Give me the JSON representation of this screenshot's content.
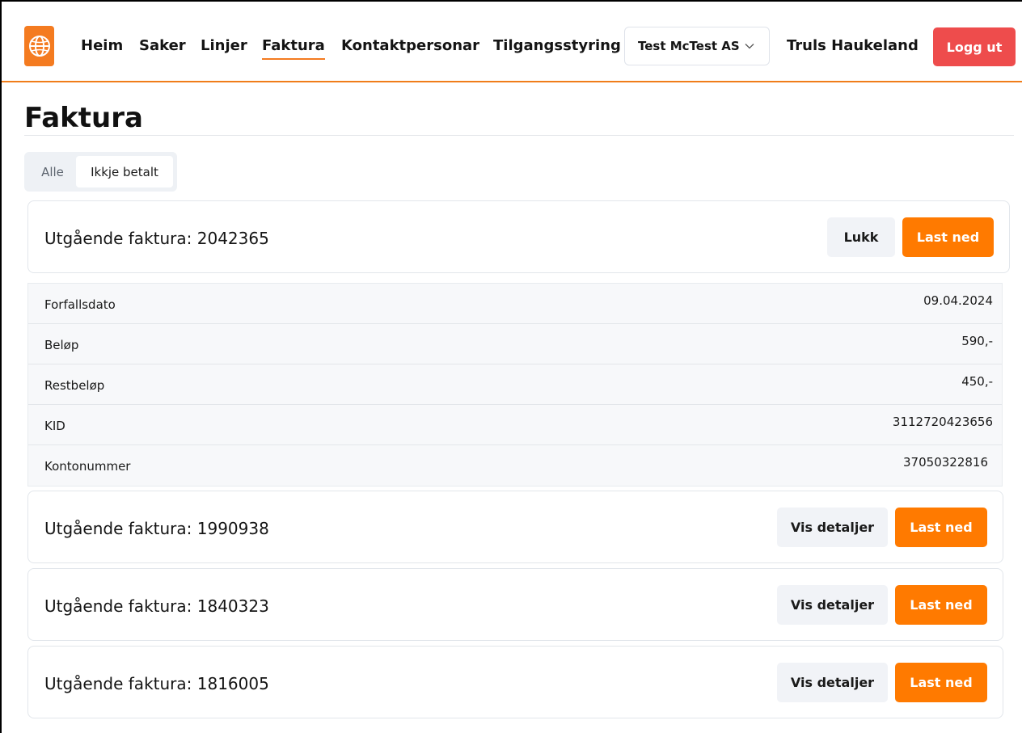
{
  "brand": {
    "accent": "#f47b20",
    "logout_color": "#ee4c4c",
    "primary_button": "#ff7a00",
    "logo_icon": "globe-icon"
  },
  "nav": {
    "items": [
      {
        "label": "Heim"
      },
      {
        "label": "Saker"
      },
      {
        "label": "Linjer"
      },
      {
        "label": "Faktura",
        "active": true
      },
      {
        "label": "Kontaktpersonar"
      },
      {
        "label": "Tilgangsstyring"
      }
    ],
    "company_select": "Test McTest AS",
    "user_name": "Truls Haukeland",
    "logout_label": "Logg ut"
  },
  "page": {
    "title": "Faktura"
  },
  "tabs": [
    {
      "label": "Alle"
    },
    {
      "label": "Ikkje betalt",
      "selected": true
    }
  ],
  "invoices": [
    {
      "title": "Utgående faktura: 2042365",
      "toggle_label": "Lukk",
      "download_label": "Last ned",
      "expanded": true,
      "details": [
        {
          "label": "Forfallsdato",
          "value": "09.04.2024"
        },
        {
          "label": "Beløp",
          "value": "590,-"
        },
        {
          "label": "Restbeløp",
          "value": "450,-"
        },
        {
          "label": "KID",
          "value": "3112720423656"
        },
        {
          "label": "Kontonummer",
          "value": "37050322816"
        }
      ]
    },
    {
      "title": "Utgående faktura: 1990938",
      "toggle_label": "Vis detaljer",
      "download_label": "Last ned"
    },
    {
      "title": "Utgående faktura: 1840323",
      "toggle_label": "Vis detaljer",
      "download_label": "Last ned"
    },
    {
      "title": "Utgående faktura: 1816005",
      "toggle_label": "Vis detaljer",
      "download_label": "Last ned"
    }
  ]
}
